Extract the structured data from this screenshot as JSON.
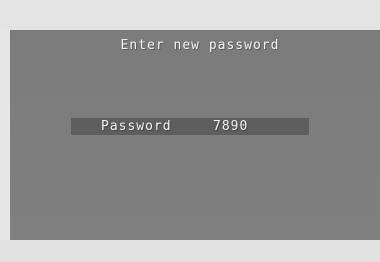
{
  "osd": {
    "title": "Enter new password",
    "password_field": {
      "label": "Password",
      "value": "7890"
    }
  },
  "colors": {
    "screen_background": "#7d7d7d",
    "highlight_row": "#5e5e5e",
    "text": "#f2f2f2",
    "outer_border": "#e4e4e4"
  }
}
